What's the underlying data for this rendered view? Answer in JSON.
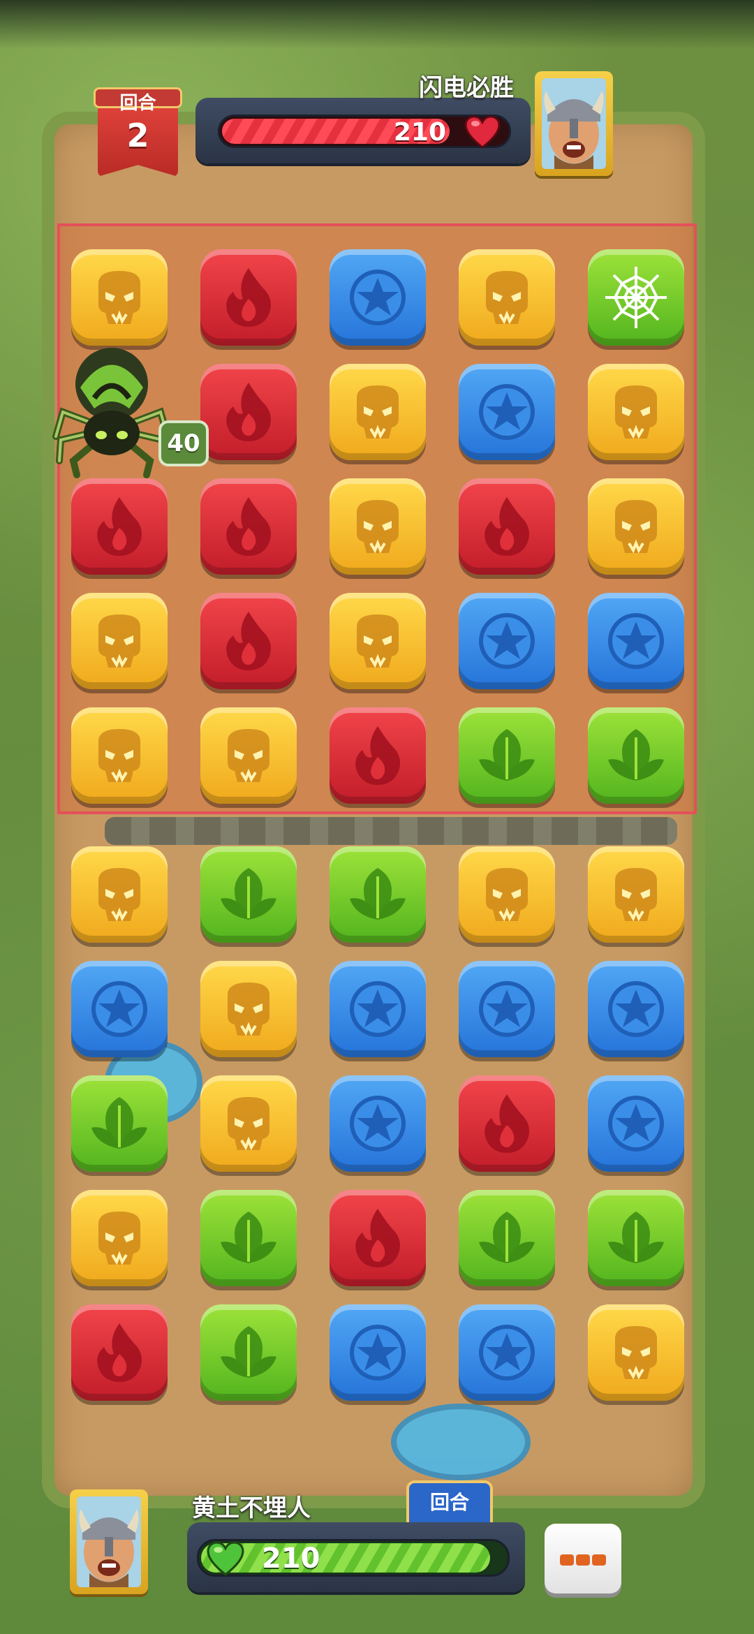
{
  "hud": {
    "round_label": "回合",
    "round_number": "2",
    "enemy_name": "闪电必胜",
    "enemy_hp": "210",
    "enemy_hp_fraction": 0.8,
    "player_name": "黄土不埋人",
    "player_hp": "210",
    "player_hp_fraction": 0.95,
    "turn_tag": "回合"
  },
  "spider": {
    "badge": "40"
  },
  "board": {
    "columns": 5,
    "enemy_rows": [
      [
        "skull",
        "fire",
        "star",
        "skull",
        "web"
      ],
      [
        "spider",
        "fire",
        "skull",
        "star",
        "skull"
      ],
      [
        "fire",
        "fire",
        "skull",
        "fire",
        "skull"
      ],
      [
        "skull",
        "fire",
        "skull",
        "star",
        "star"
      ],
      [
        "skull",
        "skull",
        "fire",
        "leaf",
        "leaf"
      ]
    ],
    "player_rows": [
      [
        "skull",
        "leaf",
        "leaf",
        "skull",
        "skull"
      ],
      [
        "star",
        "skull",
        "star",
        "star",
        "star"
      ],
      [
        "leaf",
        "skull",
        "star",
        "fire",
        "star"
      ],
      [
        "skull",
        "leaf",
        "fire",
        "leaf",
        "leaf"
      ],
      [
        "fire",
        "leaf",
        "star",
        "star",
        "skull"
      ]
    ]
  },
  "colors": {
    "skull": "#f7c234",
    "fire": "#e0303a",
    "star": "#3a8ee8",
    "leaf": "#78cc2c",
    "web": "#78cc2c",
    "enemy_zone_border": "#e4505a"
  },
  "icons": {
    "skull": "skull-icon",
    "fire": "fire-icon",
    "star": "star-icon",
    "leaf": "leaf-icon",
    "web": "spiderweb-icon",
    "heart": "heart-icon",
    "menu": "more-dots-icon"
  }
}
